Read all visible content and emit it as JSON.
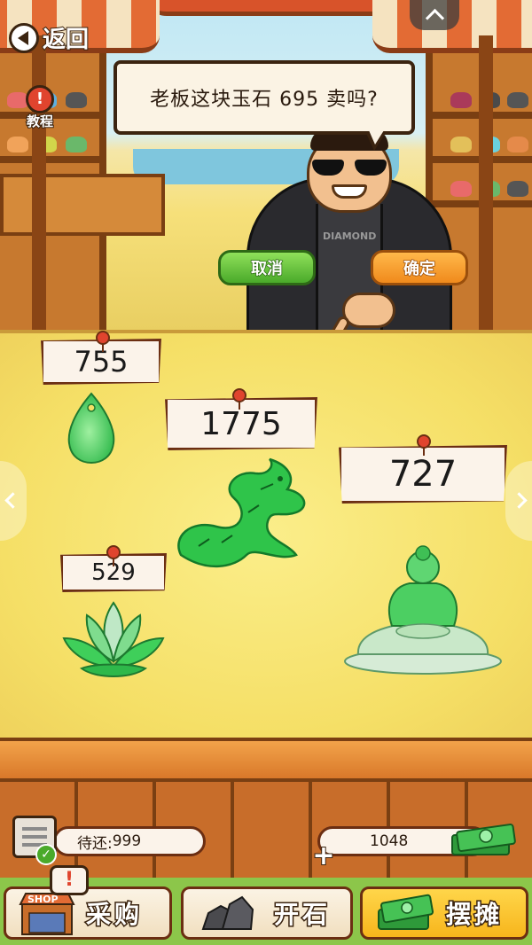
{
  "nav": {
    "back_label": "返回",
    "tutorial_label": "教程"
  },
  "dialog": {
    "question": "老板这块玉石 695 卖吗?",
    "cancel_label": "取消",
    "confirm_label": "确定"
  },
  "stall_items": [
    {
      "name": "jade-pendant",
      "price": "755"
    },
    {
      "name": "jade-dragon",
      "price": "1775"
    },
    {
      "name": "jade-buddha",
      "price": "727"
    },
    {
      "name": "jade-lotus",
      "price": "529"
    }
  ],
  "stats": {
    "debt_label": "待还:",
    "debt_value": "999",
    "money": "1048"
  },
  "shop_sign": "SHOP",
  "bottom_nav": [
    {
      "label": "采购"
    },
    {
      "label": "开石"
    },
    {
      "label": "摆摊"
    }
  ],
  "colors": {
    "board": "#f5df66",
    "cancel": "#4aaa2a",
    "confirm": "#f08a1c",
    "jade": "#3fcf5a",
    "price_tag": "#fbf3ea",
    "active_tab": "#f7b51c"
  }
}
